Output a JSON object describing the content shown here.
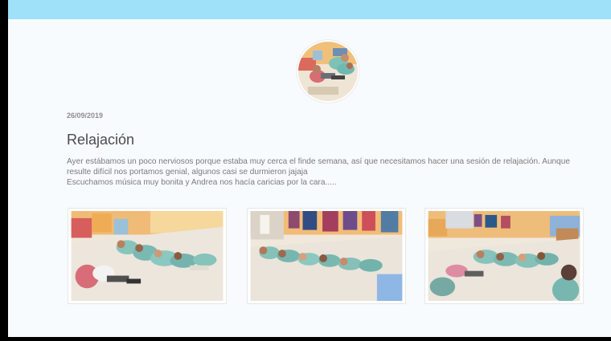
{
  "nav": {
    "items": [
      "",
      "",
      "",
      ""
    ]
  },
  "post": {
    "date": "26/09/2019",
    "title": "Relajación",
    "description_lines": [
      "Ayer estábamos un poco nerviosos porque estaba muy cerca el finde semana, así que necesitamos hacer una sesión de relajación. Aunque",
      "resulte difícil nos portamos genial, algunos casi se durmieron jajaja",
      "Escuchamos música muy bonita y Andrea nos hacía caricias por la cara....."
    ]
  },
  "media": {
    "avatar": {
      "subject": "children lying on the classroom floor"
    },
    "gallery": [
      {
        "subject": "children lying on mats"
      },
      {
        "subject": "children resting near wall with coats"
      },
      {
        "subject": "children lying on floor near shelves"
      }
    ]
  },
  "colors": {
    "topbar": "#9fe1f8",
    "page_background": "#f7fbfd",
    "title": "#4b4b4b",
    "text": "#7b7b7b",
    "date": "#8e8e8e"
  }
}
